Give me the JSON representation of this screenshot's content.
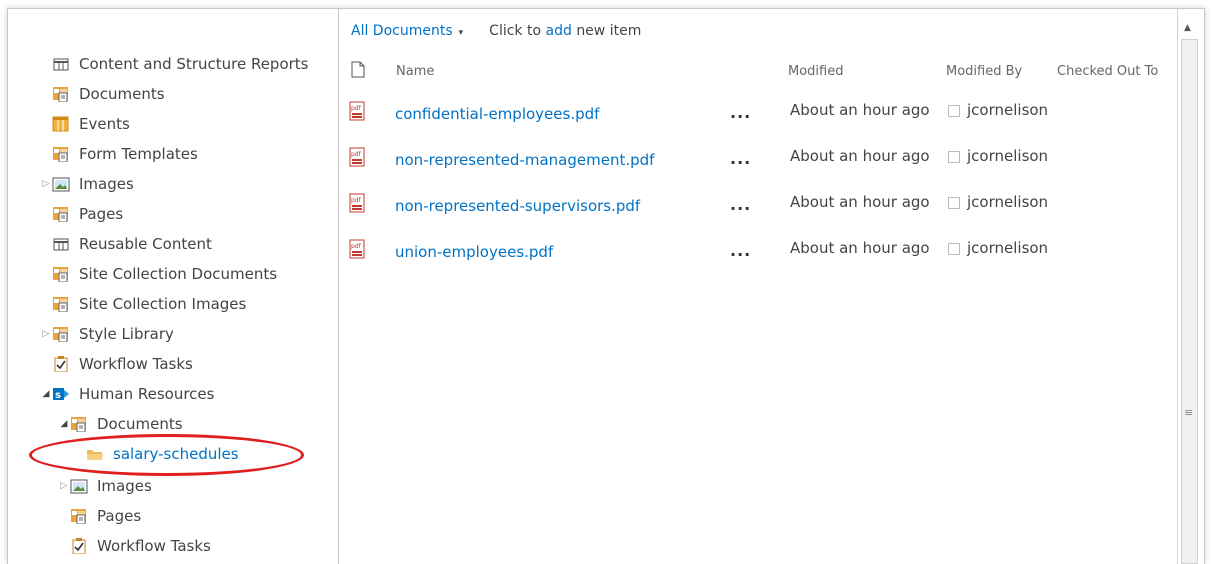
{
  "tree": {
    "items": [
      {
        "label": "Content and Structure Reports",
        "icon": "list-icon",
        "expander": ""
      },
      {
        "label": "Documents",
        "icon": "document-library-icon",
        "expander": ""
      },
      {
        "label": "Events",
        "icon": "calendar-icon",
        "expander": ""
      },
      {
        "label": "Form Templates",
        "icon": "document-library-icon",
        "expander": ""
      },
      {
        "label": "Images",
        "icon": "picture-library-icon",
        "expander": "▷"
      },
      {
        "label": "Pages",
        "icon": "document-library-icon",
        "expander": ""
      },
      {
        "label": "Reusable Content",
        "icon": "list-icon",
        "expander": ""
      },
      {
        "label": "Site Collection Documents",
        "icon": "document-library-icon",
        "expander": ""
      },
      {
        "label": "Site Collection Images",
        "icon": "document-library-icon",
        "expander": ""
      },
      {
        "label": "Style Library",
        "icon": "document-library-icon",
        "expander": "▷"
      },
      {
        "label": "Workflow Tasks",
        "icon": "task-list-icon",
        "expander": ""
      },
      {
        "label": "Human Resources",
        "icon": "sharepoint-site-icon",
        "expander": "◢"
      },
      {
        "label": "Documents",
        "icon": "document-library-icon",
        "expander": "◢"
      },
      {
        "label": "salary-schedules",
        "icon": "folder-icon",
        "expander": ""
      },
      {
        "label": "Images",
        "icon": "picture-library-icon",
        "expander": "▷"
      },
      {
        "label": "Pages",
        "icon": "document-library-icon",
        "expander": ""
      },
      {
        "label": "Workflow Tasks",
        "icon": "task-list-icon",
        "expander": ""
      }
    ]
  },
  "toolbar": {
    "view_label": "All Documents",
    "caret": "▾",
    "click_to": "Click to",
    "add": "add",
    "new_item": "new item"
  },
  "columns": {
    "name": "Name",
    "modified": "Modified",
    "modified_by": "Modified By",
    "checked_out_to": "Checked Out To"
  },
  "documents": [
    {
      "name": "confidential-employees.pdf",
      "ellipsis": "...",
      "modified": "About an hour ago",
      "modified_by": "jcornelison"
    },
    {
      "name": "non-represented-management.pdf",
      "ellipsis": "...",
      "modified": "About an hour ago",
      "modified_by": "jcornelison"
    },
    {
      "name": "non-represented-supervisors.pdf",
      "ellipsis": "...",
      "modified": "About an hour ago",
      "modified_by": "jcornelison"
    },
    {
      "name": "union-employees.pdf",
      "ellipsis": "...",
      "modified": "About an hour ago",
      "modified_by": "jcornelison"
    }
  ],
  "scrollbar": {
    "up": "▲",
    "grip": "≡"
  },
  "colors": {
    "link": "#0072c6",
    "highlight": "#e01e1e",
    "library_icon": "#e8a33a"
  }
}
